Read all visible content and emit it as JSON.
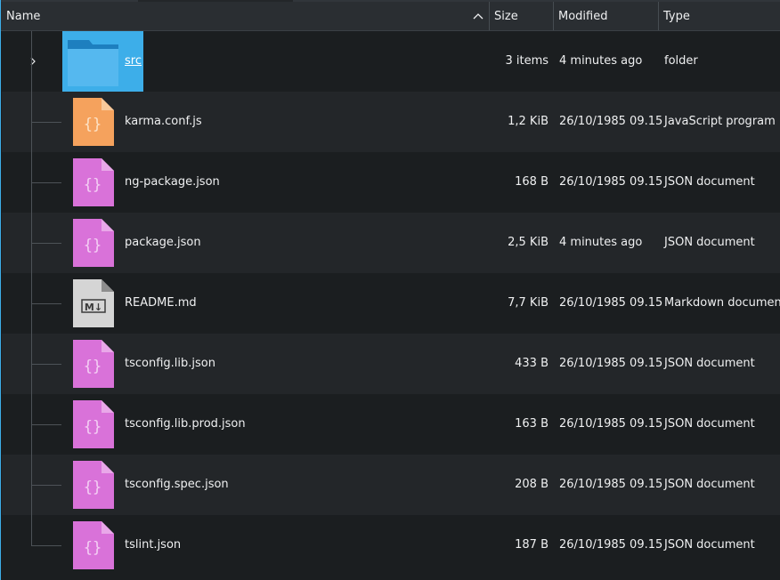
{
  "header": {
    "name": "Name",
    "size": "Size",
    "modified": "Modified",
    "type": "Type"
  },
  "rows": [
    {
      "name": "src",
      "size": "3 items",
      "modified": "4 minutes ago",
      "type": "folder",
      "icon": "folder-icon"
    },
    {
      "name": "karma.conf.js",
      "size": "1,2 KiB",
      "modified": "26/10/1985 09.15",
      "type": "JavaScript program",
      "icon": "javascript-file-icon"
    },
    {
      "name": "ng-package.json",
      "size": "168 B",
      "modified": "26/10/1985 09.15",
      "type": "JSON document",
      "icon": "json-file-icon"
    },
    {
      "name": "package.json",
      "size": "2,5 KiB",
      "modified": "4 minutes ago",
      "type": "JSON document",
      "icon": "json-file-icon"
    },
    {
      "name": "README.md",
      "size": "7,7 KiB",
      "modified": "26/10/1985 09.15",
      "type": "Markdown document",
      "icon": "markdown-file-icon"
    },
    {
      "name": "tsconfig.lib.json",
      "size": "433 B",
      "modified": "26/10/1985 09.15",
      "type": "JSON document",
      "icon": "json-file-icon"
    },
    {
      "name": "tsconfig.lib.prod.json",
      "size": "163 B",
      "modified": "26/10/1985 09.15",
      "type": "JSON document",
      "icon": "json-file-icon"
    },
    {
      "name": "tsconfig.spec.json",
      "size": "208 B",
      "modified": "26/10/1985 09.15",
      "type": "JSON document",
      "icon": "json-file-icon"
    },
    {
      "name": "tslint.json",
      "size": "187 B",
      "modified": "26/10/1985 09.15",
      "type": "JSON document",
      "icon": "json-file-icon"
    }
  ],
  "colors": {
    "selection": "#3daee9",
    "javascript": "#f5a25d",
    "json": "#d972d9",
    "markdown": "#d5d5d5"
  }
}
